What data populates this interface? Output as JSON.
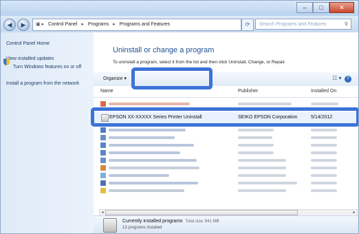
{
  "window": {
    "controls": {
      "minimize": "–",
      "maximize": "□",
      "close": "✕"
    }
  },
  "address": {
    "segments": [
      "Control Panel",
      "Programs",
      "Programs and Features"
    ],
    "search_placeholder": "Search Programs and Features"
  },
  "sidebar": {
    "items": [
      "Control Panel Home",
      "View installed updates",
      "Turn Windows features on or off",
      "Install a program from the network"
    ]
  },
  "main": {
    "heading": "Uninstall or change a program",
    "subheading": "To uninstall a program, select it from the list and then click Uninstall, Change, or Repair.",
    "toolbar": {
      "organize": "Organize ▾"
    },
    "columns": {
      "name": "Name",
      "publisher": "Publisher",
      "installed_on": "Installed On"
    },
    "selected_program": {
      "name": "EPSON XX-XXXXX Series Printer Uninstall",
      "publisher": "SEIKO EPSON Corporation",
      "installed_on": "5/14/2012"
    }
  },
  "details": {
    "title": "Currently installed programs",
    "total_size": "Total size: 941 MB",
    "count": "13 programs installed"
  },
  "colors": {
    "highlight": "#3c73d8",
    "heading": "#1e4f8f"
  }
}
